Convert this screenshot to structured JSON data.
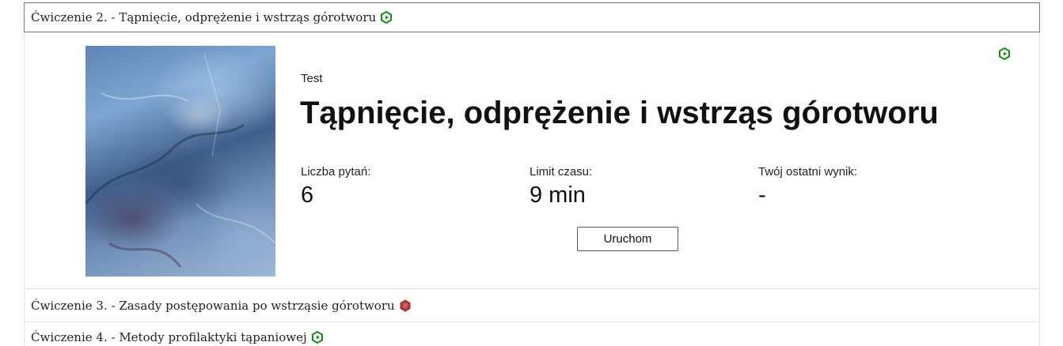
{
  "sections": [
    {
      "label": "Ćwiczenie 2. - Tąpnięcie, odprężenie i wstrząs górotworu",
      "status_icon": "green-hexagon-play-icon",
      "expanded": true
    },
    {
      "label": "Ćwiczenie 3. - Zasady postępowania po wstrząsie górotworu",
      "status_icon": "red-hexagon-icon",
      "expanded": false
    },
    {
      "label": "Ćwiczenie 4. - Metody profilaktyki tąpaniowej",
      "status_icon": "green-hexagon-play-icon",
      "expanded": false
    }
  ],
  "test_card": {
    "kind": "Test",
    "title": "Tąpnięcie, odprężenie i wstrząs górotworu",
    "stats": [
      {
        "label": "Liczba pytań:",
        "value": "6"
      },
      {
        "label": "Limit czasu:",
        "value": "9 min"
      },
      {
        "label": "Twój ostatni wynik:",
        "value": "-"
      }
    ],
    "run_button_label": "Uruchom",
    "cover_image": "blue-rock-texture-image"
  },
  "colors": {
    "green_icon": "#1a8a1a",
    "red_icon": "#b03a3a",
    "border_dark": "#777777",
    "border_light": "#e1e1e1"
  }
}
